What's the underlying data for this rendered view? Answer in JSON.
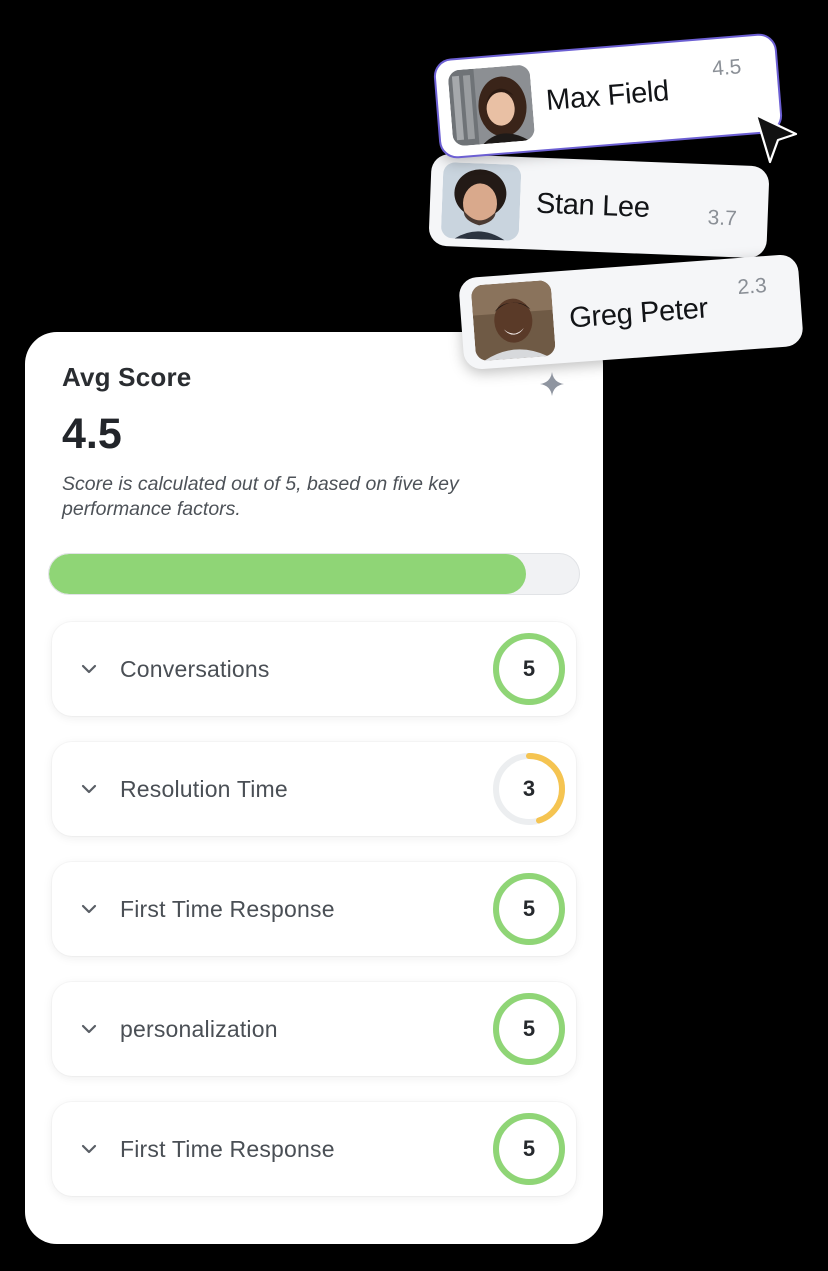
{
  "score_card": {
    "title": "Avg Score",
    "score": "4.5",
    "description": "Score is calculated out of 5, based on five key performance factors.",
    "progress_fraction": 0.9
  },
  "factors": [
    {
      "label": "Conversations",
      "score": "5",
      "fraction": 1.0,
      "color": "#8fd576"
    },
    {
      "label": "Resolution Time",
      "score": "3",
      "fraction": 0.45,
      "color": "#f5c451"
    },
    {
      "label": "First Time Response",
      "score": "5",
      "fraction": 1.0,
      "color": "#8fd576"
    },
    {
      "label": "personalization",
      "score": "5",
      "fraction": 1.0,
      "color": "#8fd576"
    },
    {
      "label": "First Time Response",
      "score": "5",
      "fraction": 1.0,
      "color": "#8fd576"
    }
  ],
  "users": [
    {
      "name": "Max Field",
      "score": "4.5",
      "selected": true
    },
    {
      "name": "Stan Lee",
      "score": "3.7",
      "selected": false
    },
    {
      "name": "Greg Peter",
      "score": "2.3",
      "selected": false
    }
  ],
  "colors": {
    "success": "#8fd576",
    "warning": "#f5c451",
    "ring_track": "#eceef0",
    "selection_border": "#6c5fd3"
  },
  "icons": {
    "chevron": "chevron-down-icon",
    "cursor": "cursor-pointer-icon",
    "sparkle": "sparkle-icon"
  }
}
